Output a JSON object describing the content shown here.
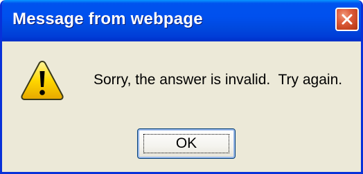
{
  "dialog": {
    "title": "Message from webpage",
    "message": "Sorry, the answer is invalid.  Try again.",
    "ok_label": "OK",
    "icon": "warning-icon",
    "close_icon": "close-icon"
  },
  "colors": {
    "titlebar": "#0050ee",
    "frame": "#0831d9",
    "body": "#ece9d8",
    "close_button": "#e0603f",
    "warning_fill": "#ffd700"
  }
}
